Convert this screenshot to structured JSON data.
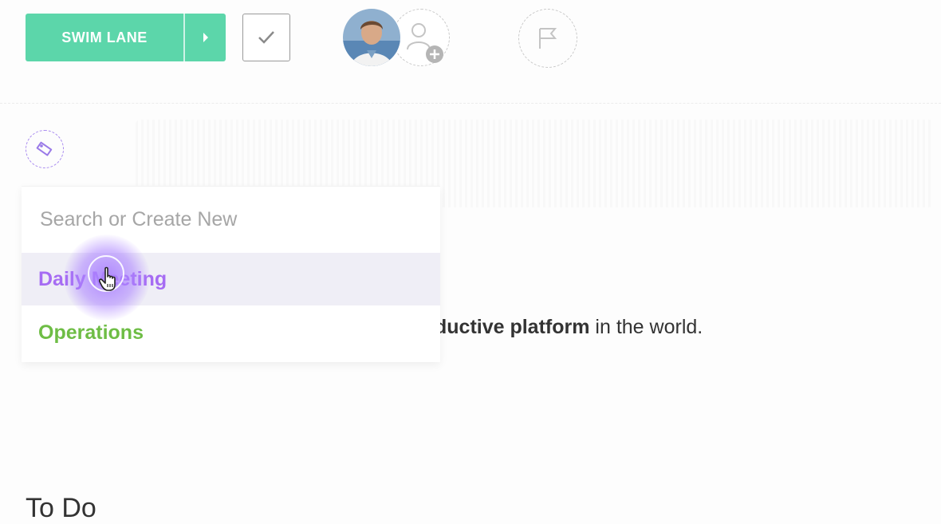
{
  "toolbar": {
    "status_label": "SWIM LANE",
    "status_color": "#5cd6aa"
  },
  "tags_dropdown": {
    "search_placeholder": "Search or Create New",
    "options": [
      {
        "label": "Daily Meeting",
        "color": "#a66cf3"
      },
      {
        "label": "Operations",
        "color": "#6ebd45"
      }
    ]
  },
  "description": {
    "bold_text": "ductive platform",
    "rest_text": " in the world."
  },
  "section": {
    "title": "To Do"
  }
}
